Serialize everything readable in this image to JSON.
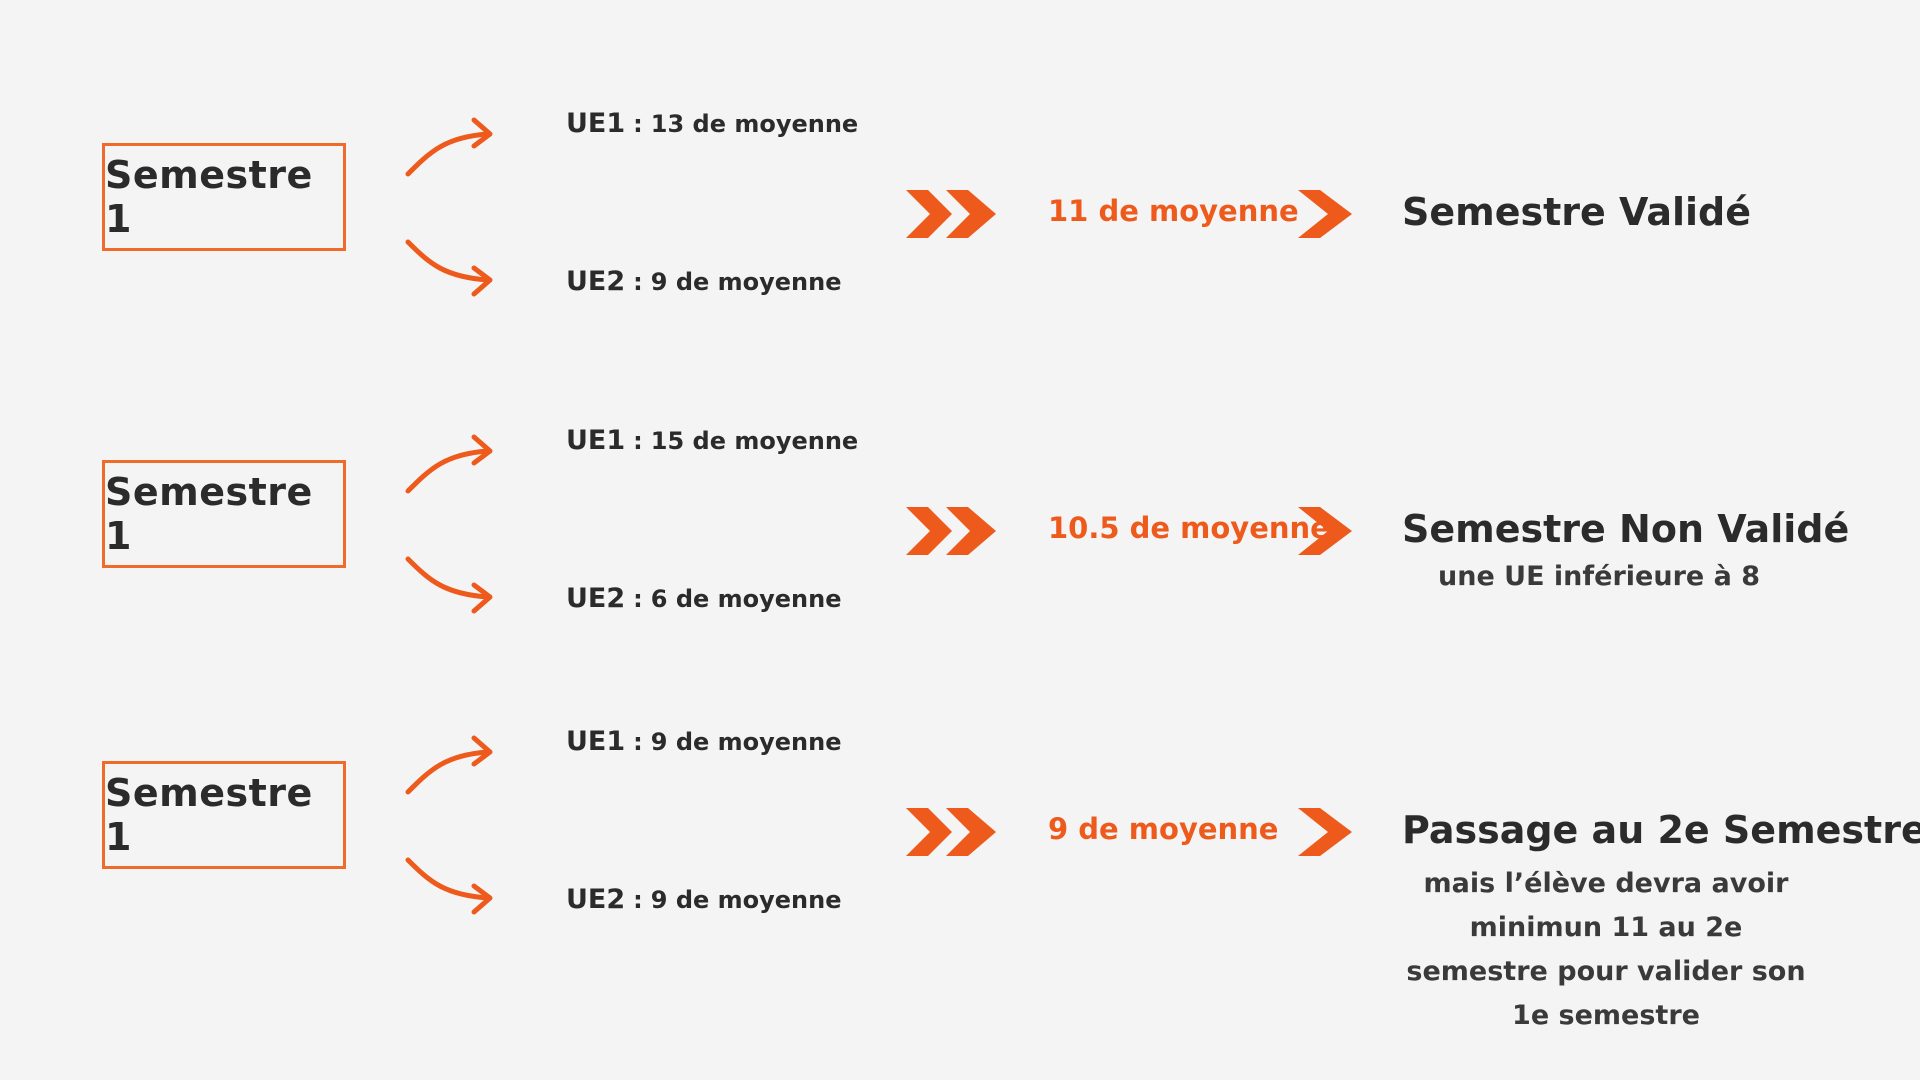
{
  "colors": {
    "accent": "#ee5a1c",
    "box_border": "#ee6b2b",
    "text": "#2b2b2b",
    "background": "#f4f4f4"
  },
  "rows": [
    {
      "semester": "Semestre 1",
      "ue1_code": "UE1",
      "ue1_colon": ":",
      "ue1_text": "13 de moyenne",
      "ue2_code": "UE2",
      "ue2_colon": ":",
      "ue2_text": "9 de moyenne",
      "average": "11 de moyenne",
      "result": "Semestre Validé",
      "note": ""
    },
    {
      "semester": "Semestre 1",
      "ue1_code": "UE1",
      "ue1_colon": ":",
      "ue1_text": "15 de moyenne",
      "ue2_code": "UE2",
      "ue2_colon": ":",
      "ue2_text": "6 de moyenne",
      "average": "10.5 de moyenne",
      "result": "Semestre Non Validé",
      "note": "une UE inférieure à 8"
    },
    {
      "semester": "Semestre 1",
      "ue1_code": "UE1",
      "ue1_colon": ":",
      "ue1_text": "9 de moyenne",
      "ue2_code": "UE2",
      "ue2_colon": ":",
      "ue2_text": "9 de moyenne",
      "average": "9 de moyenne",
      "result": "Passage au 2e Semestre",
      "note": "mais l’élève devra avoir minimun 11 au 2e semestre pour valider son 1e semestre"
    }
  ]
}
